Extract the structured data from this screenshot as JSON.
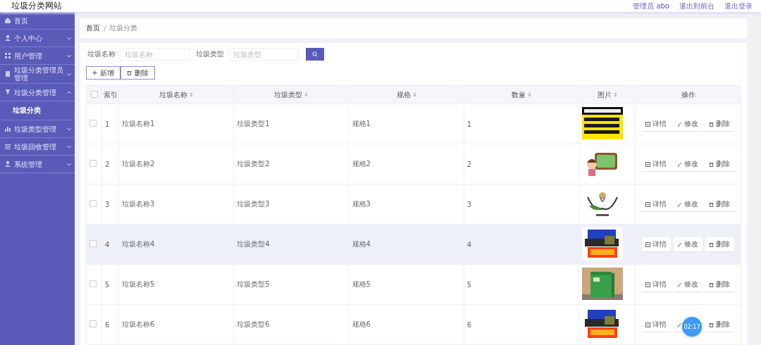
{
  "header": {
    "title": "垃圾分类网站",
    "user": "管理员 abo",
    "links": [
      "退出到前台",
      "退出登录"
    ]
  },
  "sidebar": {
    "items": [
      {
        "label": "首页"
      },
      {
        "label": "个人中心",
        "expanded": false
      },
      {
        "label": "用户管理",
        "expanded": false
      },
      {
        "label": "垃圾分类管理员管理",
        "expanded": false
      },
      {
        "label": "垃圾分类管理",
        "expanded": true,
        "children": [
          {
            "label": "垃圾分类",
            "selected": true
          }
        ]
      },
      {
        "label": "垃圾类型管理",
        "expanded": false
      },
      {
        "label": "垃圾回收管理",
        "expanded": false
      },
      {
        "label": "系统管理",
        "expanded": false
      }
    ]
  },
  "breadcrumb": {
    "items": [
      "首页",
      "垃圾分类"
    ],
    "separator": "/"
  },
  "search": {
    "fields": [
      {
        "label": "垃圾名称",
        "placeholder": "垃圾名称"
      },
      {
        "label": "垃圾类型",
        "placeholder": "垃圾类型"
      }
    ]
  },
  "toolbar": [
    {
      "label": "新增",
      "kind": "add"
    },
    {
      "label": "删除",
      "kind": "delete"
    }
  ],
  "table": {
    "select_all": {
      "checked": false
    },
    "columns": [
      {
        "label": "索引",
        "sortable": false
      },
      {
        "label": "垃圾名称",
        "sortable": true
      },
      {
        "label": "垃圾类型",
        "sortable": true
      },
      {
        "label": "规格",
        "sortable": true
      },
      {
        "label": "数量",
        "sortable": true
      },
      {
        "label": "图片",
        "sortable": true
      },
      {
        "label": "操作",
        "sortable": false
      }
    ],
    "rows": [
      {
        "checked": false,
        "highlighted": false,
        "cells": [
          "1",
          "垃圾名称1",
          "垃圾类型1",
          "规格1",
          "1"
        ],
        "image": {
          "kind": "picture"
        },
        "actions": [
          {
            "label": "详情",
            "kind": "detail"
          },
          {
            "label": "修改",
            "kind": "edit"
          },
          {
            "label": "删除",
            "kind": "delete"
          }
        ]
      },
      {
        "checked": false,
        "highlighted": false,
        "cells": [
          "2",
          "垃圾名称2",
          "垃圾类型2",
          "规格2",
          "2"
        ],
        "image": {
          "kind": "picture"
        },
        "actions": [
          {
            "label": "详情",
            "kind": "detail"
          },
          {
            "label": "修改",
            "kind": "edit"
          },
          {
            "label": "删除",
            "kind": "delete"
          }
        ]
      },
      {
        "checked": false,
        "highlighted": false,
        "cells": [
          "3",
          "垃圾名称3",
          "垃圾类型3",
          "规格3",
          "3"
        ],
        "image": {
          "kind": "picture"
        },
        "actions": [
          {
            "label": "详情",
            "kind": "detail"
          },
          {
            "label": "修改",
            "kind": "edit"
          },
          {
            "label": "删除",
            "kind": "delete"
          }
        ]
      },
      {
        "checked": false,
        "highlighted": true,
        "cells": [
          "4",
          "垃圾名称4",
          "垃圾类型4",
          "规格4",
          "4"
        ],
        "image": {
          "kind": "picture"
        },
        "actions": [
          {
            "label": "详情",
            "kind": "detail"
          },
          {
            "label": "修改",
            "kind": "edit"
          },
          {
            "label": "删除",
            "kind": "delete"
          }
        ]
      },
      {
        "checked": false,
        "highlighted": false,
        "cells": [
          "5",
          "垃圾名称5",
          "垃圾类型5",
          "规格5",
          "5"
        ],
        "image": {
          "kind": "picture"
        },
        "actions": [
          {
            "label": "详情",
            "kind": "detail"
          },
          {
            "label": "修改",
            "kind": "edit"
          },
          {
            "label": "删除",
            "kind": "delete"
          }
        ]
      },
      {
        "checked": false,
        "highlighted": false,
        "cells": [
          "6",
          "垃圾名称6",
          "垃圾类型6",
          "规格6",
          "6"
        ],
        "image": {
          "kind": "picture"
        },
        "actions": [
          {
            "label": "详情",
            "kind": "detail"
          },
          {
            "kind": "edit"
          },
          {
            "label": "删除",
            "kind": "delete"
          }
        ]
      }
    ]
  },
  "timer": "02:17"
}
